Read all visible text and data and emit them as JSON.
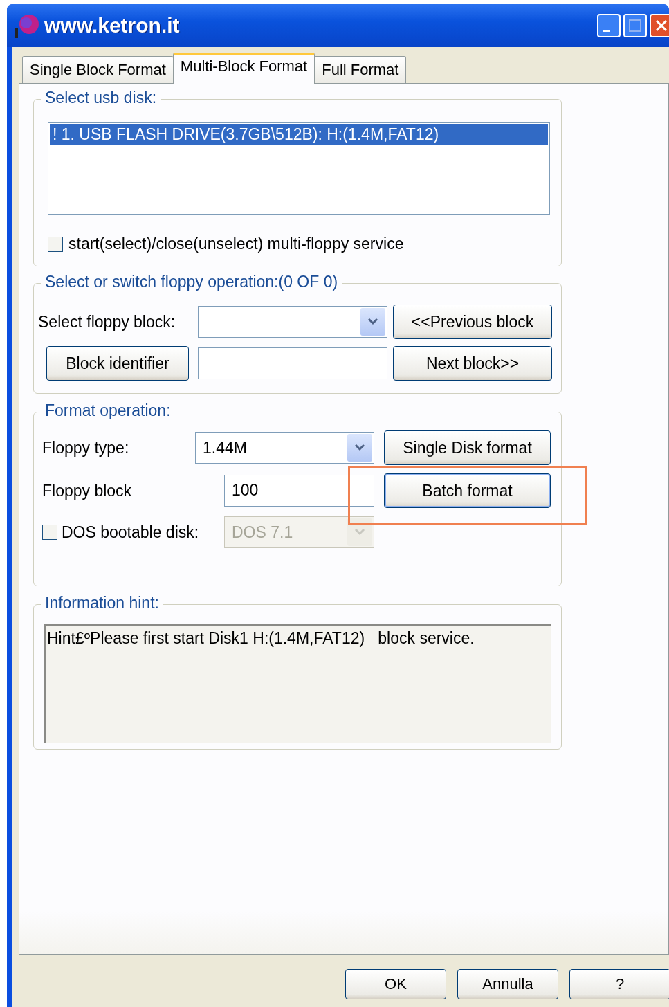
{
  "window": {
    "title": "www.ketron.it"
  },
  "tabs": [
    {
      "label": "Single Block Format",
      "selected": false
    },
    {
      "label": "Multi-Block Format",
      "selected": true
    },
    {
      "label": "Full Format",
      "selected": false
    }
  ],
  "usb_disk": {
    "title": "Select usb disk:",
    "items": [
      {
        "text": "! 1. USB FLASH DRIVE(3.7GB\\512B): H:(1.4M,FAT12)",
        "selected": true
      }
    ],
    "service": {
      "label": "start(select)/close(unselect) multi-floppy service",
      "checked": false
    }
  },
  "floppy_operation": {
    "title": "Select or switch floppy operation:(0 OF 0)",
    "select_label": "Select floppy block:",
    "previous_button": "<<Previous block",
    "identifier_button": "Block identifier",
    "next_button": "Next block>>"
  },
  "format_operation": {
    "title": "Format operation:",
    "type_label": "Floppy type:",
    "type_value": "1.44M",
    "single_button": "Single Disk format",
    "block_label": "Floppy block",
    "block_value": "100",
    "batch_button": {
      "label": "Batch format",
      "highlighted": true
    },
    "dos": {
      "label": "DOS bootable disk:",
      "checked": false,
      "value": "DOS 7.1",
      "disabled": true
    }
  },
  "hint": {
    "title": "Information hint:",
    "text": "Hint£ºPlease first start Disk1 H:(1.4M,FAT12)   block service."
  },
  "buttons": [
    "OK",
    "Annulla",
    "?"
  ]
}
